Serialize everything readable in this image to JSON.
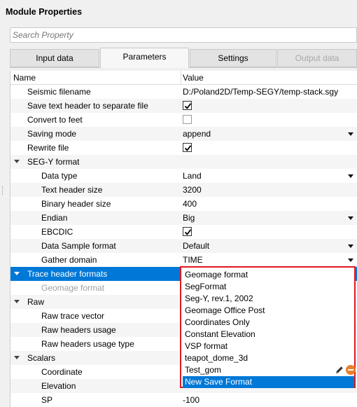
{
  "window": {
    "title": "Module Properties"
  },
  "search": {
    "placeholder": "Search Property"
  },
  "tabs": [
    {
      "label": "Input data",
      "state": "normal"
    },
    {
      "label": "Parameters",
      "state": "active"
    },
    {
      "label": "Settings",
      "state": "normal"
    },
    {
      "label": "Output data",
      "state": "disabled"
    }
  ],
  "columns": {
    "name": "Name",
    "value": "Value"
  },
  "rows": {
    "seismic_filename": {
      "name": "Seismic filename",
      "value": "D:/Poland2D/Temp-SEGY/temp-stack.sgy"
    },
    "save_text_header": {
      "name": "Save text header to separate file",
      "checked": true
    },
    "convert_to_feet": {
      "name": "Convert to feet",
      "checked": false
    },
    "saving_mode": {
      "name": "Saving mode",
      "value": "append"
    },
    "rewrite_file": {
      "name": "Rewrite file",
      "checked": true
    },
    "segy_format": {
      "name": "SEG-Y format"
    },
    "data_type": {
      "name": "Data type",
      "value": "Land"
    },
    "text_header_size": {
      "name": "Text header size",
      "value": "3200"
    },
    "binary_header_size": {
      "name": "Binary header size",
      "value": "400"
    },
    "endian": {
      "name": "Endian",
      "value": "Big"
    },
    "ebcdic": {
      "name": "EBCDIC",
      "checked": true
    },
    "data_sample_format": {
      "name": "Data Sample format",
      "value": "Default"
    },
    "gather_domain": {
      "name": "Gather domain",
      "value": "TIME"
    },
    "trace_header_formats": {
      "name": "Trace header formats"
    },
    "geomage_format": {
      "name": "Geomage format"
    },
    "raw": {
      "name": "Raw"
    },
    "raw_trace_vector": {
      "name": "Raw trace vector"
    },
    "raw_headers_usage": {
      "name": "Raw headers usage"
    },
    "raw_headers_usage_type": {
      "name": "Raw headers usage type"
    },
    "scalars": {
      "name": "Scalars"
    },
    "coordinate": {
      "name": "Coordinate"
    },
    "elevation": {
      "name": "Elevation"
    },
    "sp": {
      "name": "SP",
      "value": "-100"
    }
  },
  "dropdown": {
    "items": [
      "Geomage format",
      "SegFormat",
      "Seg-Y, rev.1, 2002",
      "Geomage Office Post",
      "Coordinates Only",
      "Constant Elevation",
      "VSP format",
      "teapot_dome_3d",
      "Test_gom",
      "New Save Format"
    ],
    "highlighted": "New Save Format",
    "item_icons": [
      "edit-icon",
      "remove-icon"
    ]
  },
  "colors": {
    "selection": "#0078d7",
    "popup_border": "#e0191f",
    "remove_icon": "#e87f2a"
  }
}
